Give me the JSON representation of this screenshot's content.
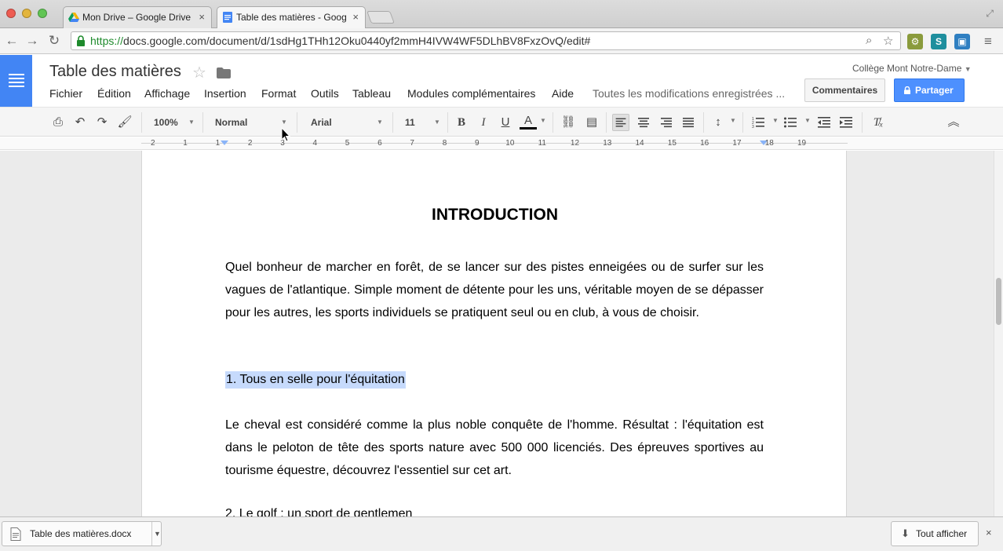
{
  "browser": {
    "tabs": [
      {
        "title": "Mon Drive – Google Drive",
        "close": "×"
      },
      {
        "title": "Table des matières - Goog",
        "close": "×"
      }
    ],
    "url": {
      "scheme": "https://",
      "rest": "docs.google.com/document/d/1sdHg1THh12Oku0440yf2mmH4IVW4WF5DLhBV8FxzOvQ/edit#"
    },
    "back_icon": "arrow-left-icon",
    "forward_icon": "arrow-right-icon",
    "reload_icon": "reload-icon"
  },
  "doc": {
    "title": "Table des matières",
    "account": "Collège Mont Notre-Dame",
    "comments_label": "Commentaires",
    "share_label": "Partager",
    "saved_status": "Toutes les modifications enregistrées ...",
    "menu": [
      "Fichier",
      "Édition",
      "Affichage",
      "Insertion",
      "Format",
      "Outils",
      "Tableau",
      "Modules complémentaires",
      "Aide"
    ]
  },
  "toolbar": {
    "zoom": "100%",
    "style": "Normal",
    "font": "Arial",
    "font_size": "11",
    "bold": "B",
    "italic": "I",
    "underline": "U",
    "text_color": "A"
  },
  "ruler": {
    "ticks": [
      "2",
      "1",
      "1",
      "2",
      "3",
      "4",
      "5",
      "6",
      "7",
      "8",
      "9",
      "10",
      "11",
      "12",
      "13",
      "14",
      "15",
      "16",
      "17",
      "18",
      "19"
    ]
  },
  "content": {
    "heading": "INTRODUCTION",
    "intro": "Quel bonheur de marcher en forêt, de se lancer sur des pistes enneigées ou de surfer sur les vagues de l'atlantique. Simple moment de détente pour les uns, véritable moyen de se dépasser pour les autres, les sports individuels se pratiquent seul ou en club, à vous de choisir.",
    "section1_title": "1. Tous en selle pour l'équitation",
    "section1_body": "Le cheval est considéré comme la plus noble conquête de l'homme. Résultat : l'équitation est dans le peloton de tête des sports nature avec 500 000 licenciés. Des épreuves sportives au tourisme équestre, découvrez l'essentiel sur cet art.",
    "section2_title": "2. Le golf : un sport de gentlemen"
  },
  "downloads": {
    "file_name": "Table des matières.docx",
    "show_all": "Tout afficher",
    "close": "×"
  },
  "colors": {
    "docs_blue": "#4285f4",
    "share_blue": "#4d90fe",
    "selection": "#c6dafc",
    "https_green": "#1e8a2c"
  }
}
